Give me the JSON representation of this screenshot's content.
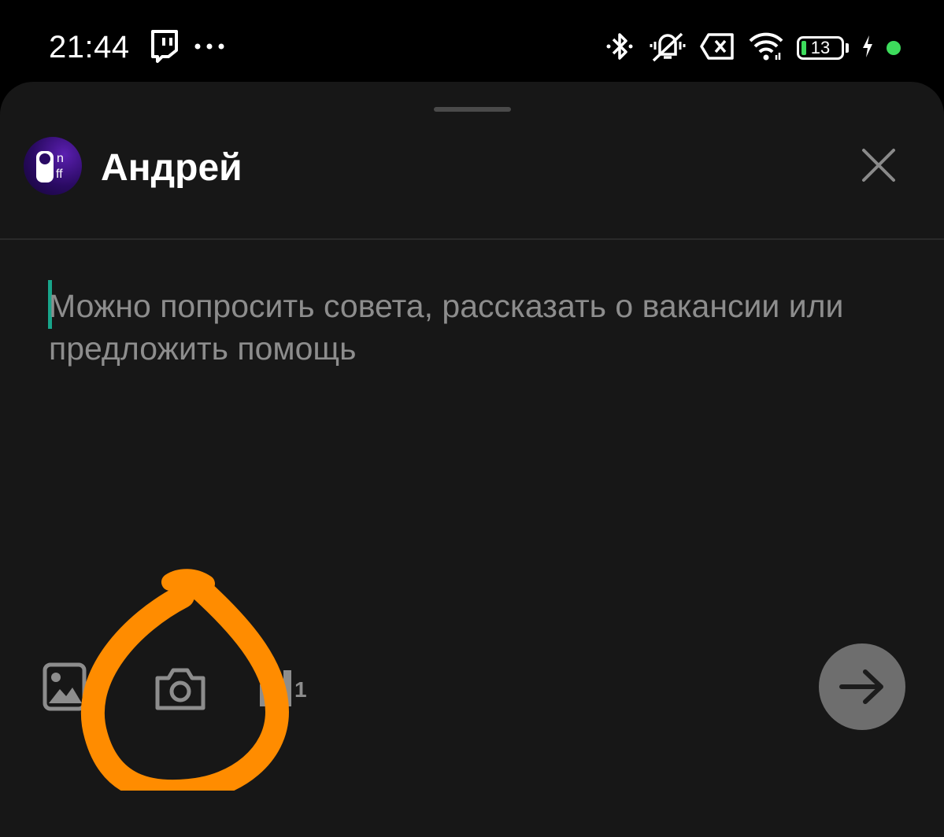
{
  "status_bar": {
    "time": "21:44",
    "battery_level": "13",
    "icons": [
      "twitch-icon",
      "more-dots-icon",
      "bluetooth-icon",
      "vibrate-off-icon",
      "no-sim-icon",
      "wifi-icon",
      "battery-icon",
      "charging-icon",
      "charging-dot"
    ]
  },
  "composer": {
    "author_name": "Андрей",
    "placeholder": "Можно попросить совета, рассказать о вакансии или предложить помощь",
    "toolbar": {
      "icons": [
        "gallery-icon",
        "camera-icon",
        "poll-icon"
      ],
      "poll_count": "1"
    },
    "send_icon": "arrow-right-icon",
    "close_icon": "close-icon"
  },
  "colors": {
    "sheet_background": "#171717",
    "cursor": "#18a58a",
    "annotation": "#ff8c00",
    "charge_indicator": "#3ddc5c",
    "send_button": "#6e6e6e"
  }
}
